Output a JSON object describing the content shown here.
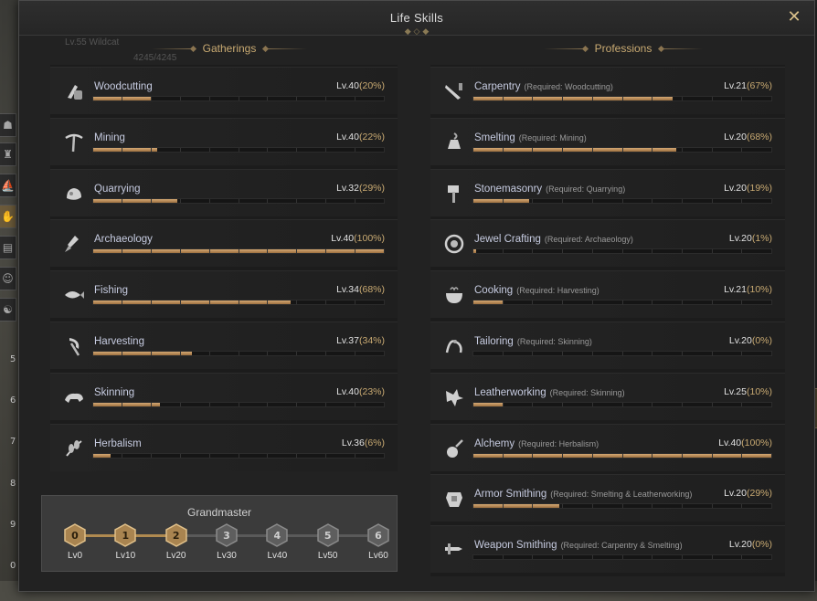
{
  "window": {
    "title": "Life Skills",
    "close_label": "✕",
    "ghost_texts": [
      "Lv.55 Wildcat",
      "4245/4245"
    ]
  },
  "gatherings": {
    "header": "Gatherings",
    "skills": [
      {
        "icon": "woodcutting-icon",
        "name": "Woodcutting",
        "level": "Lv.40",
        "percent": "(20%)",
        "segments": 10,
        "progress": 0.2
      },
      {
        "icon": "mining-icon",
        "name": "Mining",
        "level": "Lv.40",
        "percent": "(22%)",
        "segments": 10,
        "progress": 0.22
      },
      {
        "icon": "quarrying-icon",
        "name": "Quarrying",
        "level": "Lv.32",
        "percent": "(29%)",
        "segments": 10,
        "progress": 0.29
      },
      {
        "icon": "archaeology-icon",
        "name": "Archaeology",
        "level": "Lv.40",
        "percent": "(100%)",
        "segments": 10,
        "progress": 1.0
      },
      {
        "icon": "fishing-icon",
        "name": "Fishing",
        "level": "Lv.34",
        "percent": "(68%)",
        "segments": 10,
        "progress": 0.68
      },
      {
        "icon": "harvesting-icon",
        "name": "Harvesting",
        "level": "Lv.37",
        "percent": "(34%)",
        "segments": 10,
        "progress": 0.34
      },
      {
        "icon": "skinning-icon",
        "name": "Skinning",
        "level": "Lv.40",
        "percent": "(23%)",
        "segments": 10,
        "progress": 0.23
      },
      {
        "icon": "herbalism-icon",
        "name": "Herbalism",
        "level": "Lv.36",
        "percent": "(6%)",
        "segments": 10,
        "progress": 0.06
      }
    ]
  },
  "professions": {
    "header": "Professions",
    "skills": [
      {
        "icon": "carpentry-icon",
        "name": "Carpentry",
        "req": "(Required: Woodcutting)",
        "level": "Lv.21",
        "percent": "(67%)",
        "segments": 10,
        "progress": 0.67
      },
      {
        "icon": "smelting-icon",
        "name": "Smelting",
        "req": "(Required: Mining)",
        "level": "Lv.20",
        "percent": "(68%)",
        "segments": 10,
        "progress": 0.68
      },
      {
        "icon": "stonemasonry-icon",
        "name": "Stonemasonry",
        "req": "(Required: Quarrying)",
        "level": "Lv.20",
        "percent": "(19%)",
        "segments": 10,
        "progress": 0.19
      },
      {
        "icon": "jewel-crafting-icon",
        "name": "Jewel Crafting",
        "req": "(Required: Archaeology)",
        "level": "Lv.20",
        "percent": "(1%)",
        "segments": 10,
        "progress": 0.01
      },
      {
        "icon": "cooking-icon",
        "name": "Cooking",
        "req": "(Required: Harvesting)",
        "level": "Lv.21",
        "percent": "(10%)",
        "segments": 10,
        "progress": 0.1
      },
      {
        "icon": "tailoring-icon",
        "name": "Tailoring",
        "req": "(Required: Skinning)",
        "level": "Lv.20",
        "percent": "(0%)",
        "segments": 10,
        "progress": 0.0
      },
      {
        "icon": "leatherworking-icon",
        "name": "Leatherworking",
        "req": "(Required: Skinning)",
        "level": "Lv.25",
        "percent": "(10%)",
        "segments": 10,
        "progress": 0.1
      },
      {
        "icon": "alchemy-icon",
        "name": "Alchemy",
        "req": "(Required: Herbalism)",
        "level": "Lv.40",
        "percent": "(100%)",
        "segments": 10,
        "progress": 1.0
      },
      {
        "icon": "armor-smithing-icon",
        "name": "Armor Smithing",
        "req": "(Required: Smelting & Leatherworking)",
        "level": "Lv.20",
        "percent": "(29%)",
        "segments": 10,
        "progress": 0.29
      },
      {
        "icon": "weapon-smithing-icon",
        "name": "Weapon Smithing",
        "req": "(Required: Carpentry & Smelting)",
        "level": "Lv.20",
        "percent": "(0%)",
        "segments": 10,
        "progress": 0.0
      }
    ]
  },
  "grandmaster": {
    "title": "Grandmaster",
    "tiers": [
      {
        "num": "0",
        "label": "Lv0",
        "achieved": true
      },
      {
        "num": "1",
        "label": "Lv10",
        "achieved": true
      },
      {
        "num": "2",
        "label": "Lv20",
        "achieved": true
      },
      {
        "num": "3",
        "label": "Lv30",
        "achieved": false
      },
      {
        "num": "4",
        "label": "Lv40",
        "achieved": false
      },
      {
        "num": "5",
        "label": "Lv50",
        "achieved": false
      },
      {
        "num": "6",
        "label": "Lv60",
        "achieved": false
      }
    ]
  },
  "sidebar": {
    "numbers": [
      "5",
      "6",
      "7",
      "8",
      "9",
      "0"
    ]
  },
  "colors": {
    "accent_gold": "#c9aa72",
    "bar_fill": "#c29463",
    "skill_name": "#c6cbe0"
  }
}
